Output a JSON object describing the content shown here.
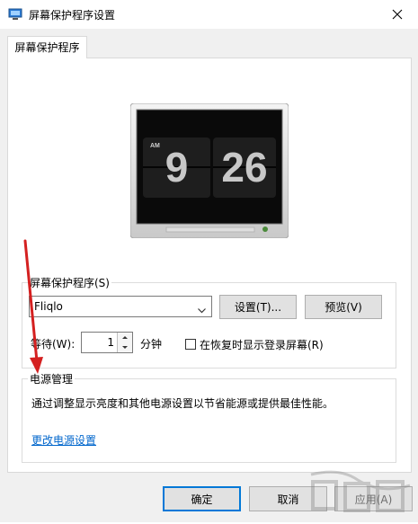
{
  "window": {
    "title": "屏幕保护程序设置",
    "close_icon": "close-icon"
  },
  "tab": {
    "label": "屏幕保护程序"
  },
  "preview": {
    "clock_ampm": "AM",
    "clock_hour": "9",
    "clock_minute": "26"
  },
  "screensaver": {
    "group_label": "屏幕保护程序(S)",
    "selected": "Fliqlo",
    "settings_button": "设置(T)...",
    "preview_button": "预览(V)",
    "wait_label": "等待(W):",
    "wait_value": "1",
    "wait_unit": "分钟",
    "logon_checkbox_label": "在恢复时显示登录屏幕(R)",
    "logon_checked": false
  },
  "power": {
    "group_label": "电源管理",
    "description": "通过调整显示亮度和其他电源设置以节省能源或提供最佳性能。",
    "link": "更改电源设置"
  },
  "footer": {
    "ok_button": "确定",
    "cancel_button": "取消",
    "apply_button": "应用(A)"
  },
  "watermark": {
    "text": "下载吧"
  },
  "colors": {
    "accent": "#0078d7",
    "link": "#0066cc",
    "annotation_arrow": "#d42020"
  }
}
